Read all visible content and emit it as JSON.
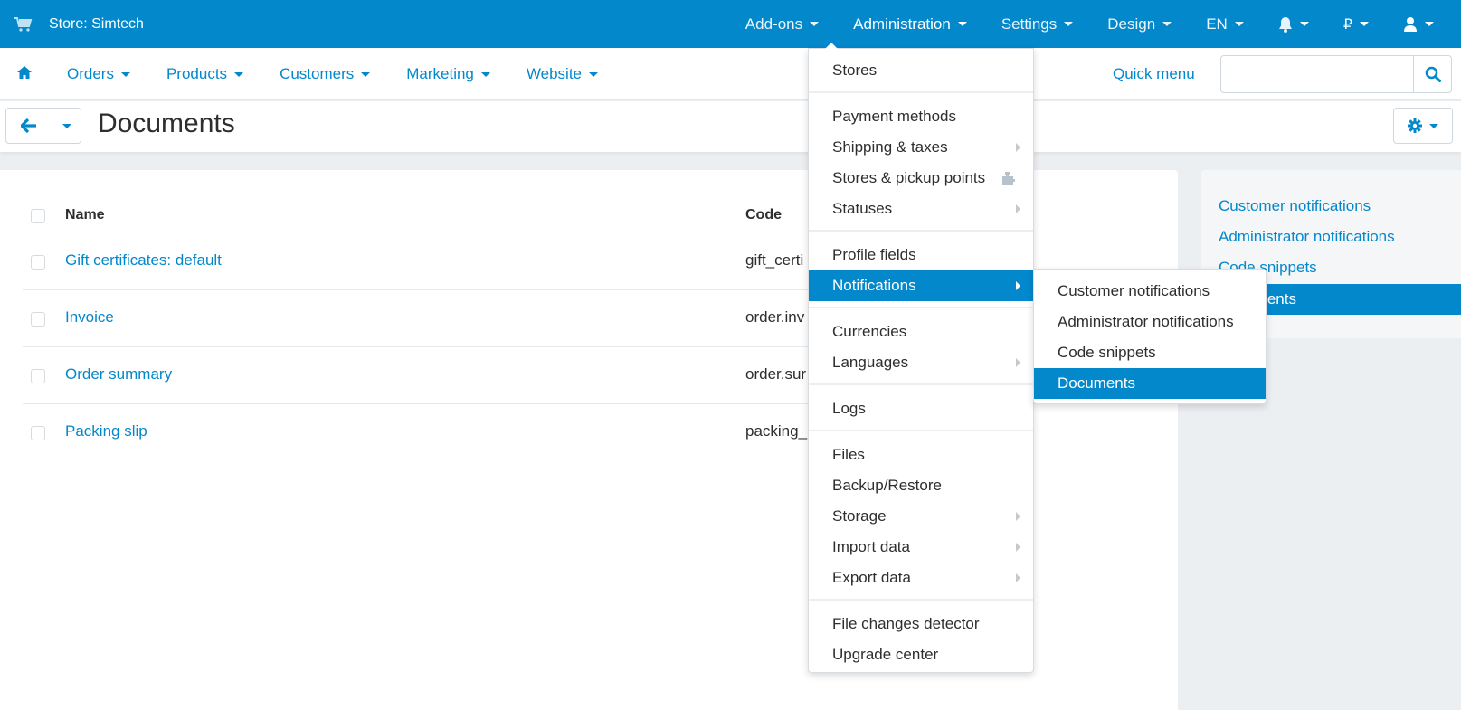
{
  "topbar": {
    "store_label": "Store: Simtech",
    "items": [
      {
        "label": "Add-ons"
      },
      {
        "label": "Administration",
        "active": true
      },
      {
        "label": "Settings"
      },
      {
        "label": "Design"
      },
      {
        "label": "EN"
      }
    ],
    "icon_items": [
      {
        "icon": "bell-icon"
      },
      {
        "icon": "ruble-icon",
        "glyph": "₽"
      },
      {
        "icon": "user-icon"
      }
    ]
  },
  "mainnav": {
    "home_icon": "home-icon",
    "links": [
      {
        "label": "Orders"
      },
      {
        "label": "Products"
      },
      {
        "label": "Customers"
      },
      {
        "label": "Marketing"
      },
      {
        "label": "Website"
      }
    ],
    "quick_menu": "Quick menu",
    "search": {
      "value": "",
      "placeholder": ""
    }
  },
  "titlebar": {
    "title": "Documents"
  },
  "table": {
    "headers": {
      "name": "Name",
      "code": "Code"
    },
    "rows": [
      {
        "name": "Gift certificates: default",
        "code": "gift_certi"
      },
      {
        "name": "Invoice",
        "code": "order.inv"
      },
      {
        "name": "Order summary",
        "code": "order.sur"
      },
      {
        "name": "Packing slip",
        "code": "packing_"
      }
    ]
  },
  "sidebar": {
    "items": [
      {
        "label": "Customer notifications"
      },
      {
        "label": "Administrator notifications"
      },
      {
        "label": "Code snippets"
      },
      {
        "label": "Documents",
        "active": true
      }
    ]
  },
  "dropdown": {
    "items": [
      {
        "label": "Stores"
      },
      {
        "label": "Payment methods"
      },
      {
        "label": "Shipping & taxes",
        "submenu": true
      },
      {
        "label": "Stores & pickup points",
        "addon": true
      },
      {
        "label": "Statuses",
        "submenu": true
      },
      {
        "label": "Profile fields"
      },
      {
        "label": "Notifications",
        "submenu": true,
        "active": true
      },
      {
        "label": "Currencies"
      },
      {
        "label": "Languages",
        "submenu": true
      },
      {
        "label": "Logs"
      },
      {
        "label": "Files"
      },
      {
        "label": "Backup/Restore"
      },
      {
        "label": "Storage",
        "submenu": true
      },
      {
        "label": "Import data",
        "submenu": true
      },
      {
        "label": "Export data",
        "submenu": true
      },
      {
        "label": "File changes detector"
      },
      {
        "label": "Upgrade center"
      }
    ]
  },
  "submenu": {
    "items": [
      {
        "label": "Customer notifications"
      },
      {
        "label": "Administrator notifications"
      },
      {
        "label": "Code snippets"
      },
      {
        "label": "Documents",
        "active": true
      }
    ]
  },
  "colors": {
    "accent": "#0388cc",
    "text": "#2e2e2e",
    "page_bg": "#eceff2"
  }
}
